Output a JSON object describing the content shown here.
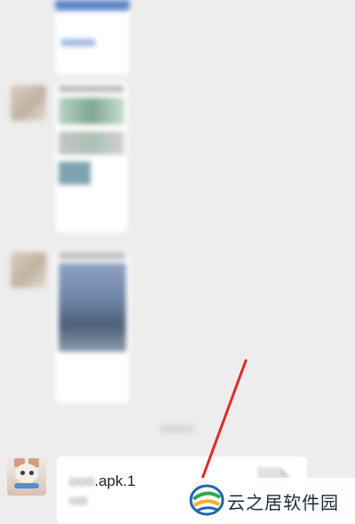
{
  "file_message": {
    "file_name_hidden": "ooo",
    "file_name_visible": ".apk.1",
    "file_size_unit": "MB"
  },
  "watermark": {
    "text": "云之居软件园"
  },
  "colors": {
    "arrow": "#e02a2a",
    "chat_background": "#ededed",
    "bubble": "#ffffff",
    "accent_blue": "#5b86c6"
  },
  "icons": [
    "file-icon",
    "arrow-annotation",
    "site-logo-icon"
  ]
}
